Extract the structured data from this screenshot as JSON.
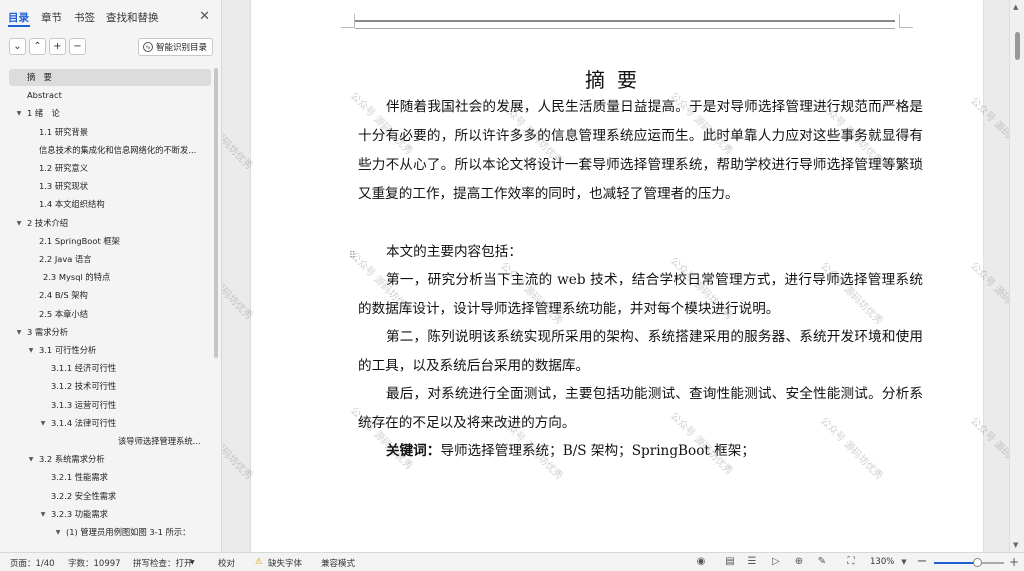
{
  "sidebar": {
    "tabs": [
      "目录",
      "章节",
      "书签",
      "查找和替换"
    ],
    "close": "✕",
    "tools": [
      "⌄",
      "⌃",
      "+",
      "−"
    ],
    "smart_button": "智能识别目录",
    "toc": [
      {
        "label": "摘　要",
        "level": 0,
        "caret": false,
        "selected": true
      },
      {
        "label": "Abstract",
        "level": 0,
        "caret": false
      },
      {
        "label": "1  绪　论",
        "level": 0,
        "caret": true
      },
      {
        "label": "1.1 研究背景",
        "level": 1,
        "caret": false
      },
      {
        "label": "信息技术的集成化和信息网络化的不断发...",
        "level": 1,
        "caret": false
      },
      {
        "label": "1.2  研究意义",
        "level": 1,
        "caret": false
      },
      {
        "label": "1.3 研究现状",
        "level": 1,
        "caret": false
      },
      {
        "label": "1.4 本文组织结构",
        "level": 1,
        "caret": false
      },
      {
        "label": "2  技术介绍",
        "level": 0,
        "caret": true
      },
      {
        "label": "2.1 SpringBoot 框架",
        "level": 1,
        "caret": false
      },
      {
        "label": "2.2 Java 语言",
        "level": 1,
        "caret": false
      },
      {
        "label": "2.3 Mysql 的特点",
        "level": 1,
        "caret": false,
        "indent_extra": true
      },
      {
        "label": "2.4 B/S 架构",
        "level": 1,
        "caret": false
      },
      {
        "label": "2.5 本章小结",
        "level": 1,
        "caret": false
      },
      {
        "label": "3 需求分析",
        "level": 0,
        "caret": true
      },
      {
        "label": "3.1 可行性分析",
        "level": 1,
        "caret": true
      },
      {
        "label": "3.1.1 经济可行性",
        "level": 2,
        "caret": false
      },
      {
        "label": "3.1.2 技术可行性",
        "level": 2,
        "caret": false
      },
      {
        "label": "3.1.3 运营可行性",
        "level": 2,
        "caret": false
      },
      {
        "label": "3.1.4 法律可行性",
        "level": 2,
        "caret": true
      },
      {
        "label": "该导师选择管理系统...",
        "level": 3,
        "caret": false
      },
      {
        "label": "3.2 系统需求分析",
        "level": 1,
        "caret": true
      },
      {
        "label": "3.2.1 性能需求",
        "level": 2,
        "caret": false
      },
      {
        "label": "3.2.2  安全性需求",
        "level": 2,
        "caret": false
      },
      {
        "label": "3.2.3 功能需求",
        "level": 2,
        "caret": true
      },
      {
        "label": "(1)  管理员用例图如图 3-1 所示：",
        "level": 3,
        "caret": true,
        "sub": true
      }
    ]
  },
  "document": {
    "title": "摘要",
    "paragraphs": [
      "伴随着我国社会的发展，人民生活质量日益提高。于是对导师选择管理进行规范而严格是十分有必要的，所以许许多多的信息管理系统应运而生。此时单靠人力应对这些事务就显得有些力不从心了。所以本论文将设计一套导师选择管理系统，帮助学校进行导师选择管理等繁琐又重复的工作，提高工作效率的同时，也减轻了管理者的压力。",
      "本文的主要内容包括：",
      "第一，研究分析当下主流的 web 技术，结合学校日常管理方式，进行导师选择管理系统的数据库设计，设计导师选择管理系统功能，并对每个模块进行说明。",
      "第二，陈列说明该系统实现所采用的架构、系统搭建采用的服务器、系统开发环境和使用的工具，以及系统后台采用的数据库。",
      "最后，对系统进行全面测试，主要包括功能测试、查询性能测试、安全性能测试。分析系统存在的不足以及将来改进的方向。"
    ],
    "keywords_label": "关键词：",
    "keywords": "导师选择管理系统；B/S 架构；SpringBoot 框架；",
    "watermark": "公众号 源码坊优秀"
  },
  "status": {
    "page": "页面：1/40",
    "words": "字数：10997",
    "spell": "拼写检查：打开",
    "proof": "校对",
    "missing_font": "缺失字体",
    "compat": "兼容模式",
    "zoom": "130%",
    "zoom_fraction": 0.62
  },
  "colors": {
    "accent": "#1f5fd6"
  }
}
